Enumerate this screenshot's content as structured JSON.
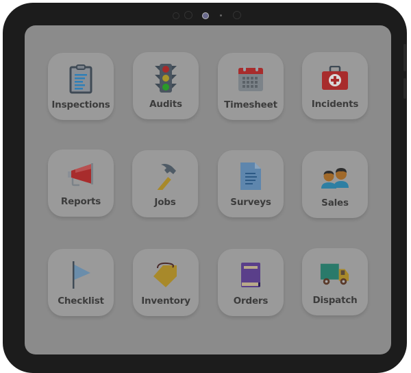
{
  "apps": [
    {
      "id": "inspections",
      "label": "Inspections",
      "icon": "clipboard-icon"
    },
    {
      "id": "audits",
      "label": "Audits",
      "icon": "traffic-light-icon"
    },
    {
      "id": "timesheet",
      "label": "Timesheet",
      "icon": "calendar-icon"
    },
    {
      "id": "incidents",
      "label": "Incidents",
      "icon": "first-aid-kit-icon"
    },
    {
      "id": "reports",
      "label": "Reports",
      "icon": "megaphone-icon"
    },
    {
      "id": "jobs",
      "label": "Jobs",
      "icon": "hammer-icon"
    },
    {
      "id": "surveys",
      "label": "Surveys",
      "icon": "document-icon"
    },
    {
      "id": "sales",
      "label": "Sales",
      "icon": "people-icon"
    },
    {
      "id": "checklist",
      "label": "Checklist",
      "icon": "flag-icon"
    },
    {
      "id": "inventory",
      "label": "Inventory",
      "icon": "price-tag-icon"
    },
    {
      "id": "orders",
      "label": "Orders",
      "icon": "book-icon"
    },
    {
      "id": "dispatch",
      "label": "Dispatch",
      "icon": "delivery-truck-icon"
    }
  ]
}
